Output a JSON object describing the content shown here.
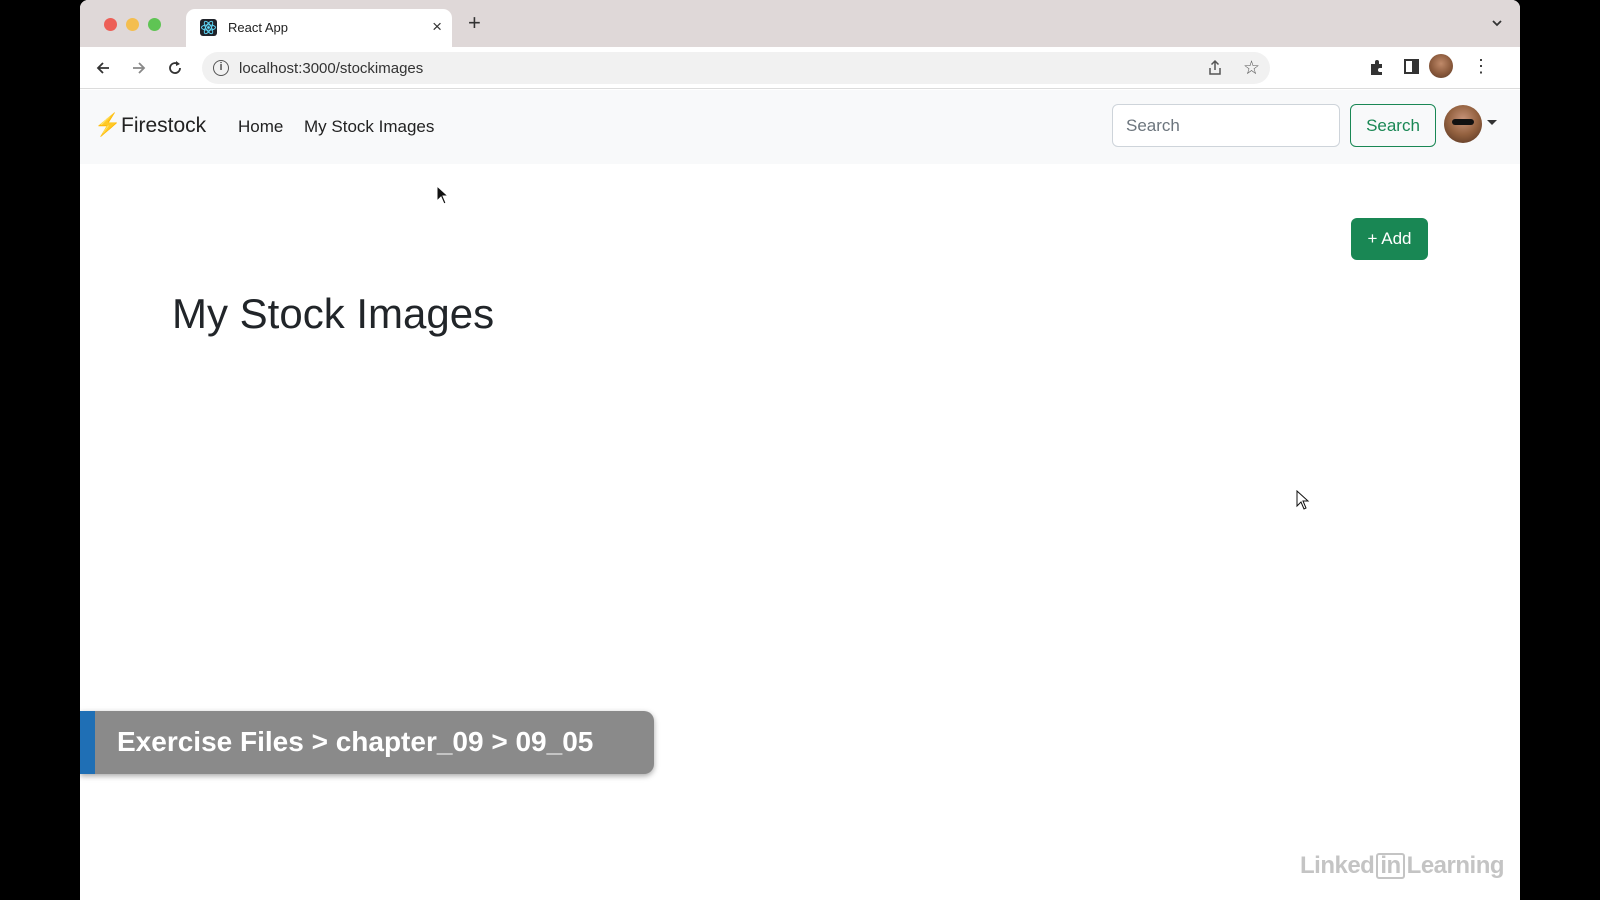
{
  "browser": {
    "tab_title": "React App",
    "url": "localhost:3000/stockimages"
  },
  "navbar": {
    "brand": "Firestock",
    "links": [
      "Home",
      "My Stock Images"
    ],
    "search_placeholder": "Search",
    "search_button": "Search"
  },
  "main": {
    "add_button": "+ Add",
    "title": "My Stock Images"
  },
  "overlay": {
    "exercise_path": "Exercise Files > chapter_09 > 09_05",
    "watermark": [
      "Linked",
      "in",
      "Learning"
    ]
  },
  "colors": {
    "success": "#198754",
    "brand_icon": "#ffc107",
    "banner_accent": "#1f6fb5"
  }
}
